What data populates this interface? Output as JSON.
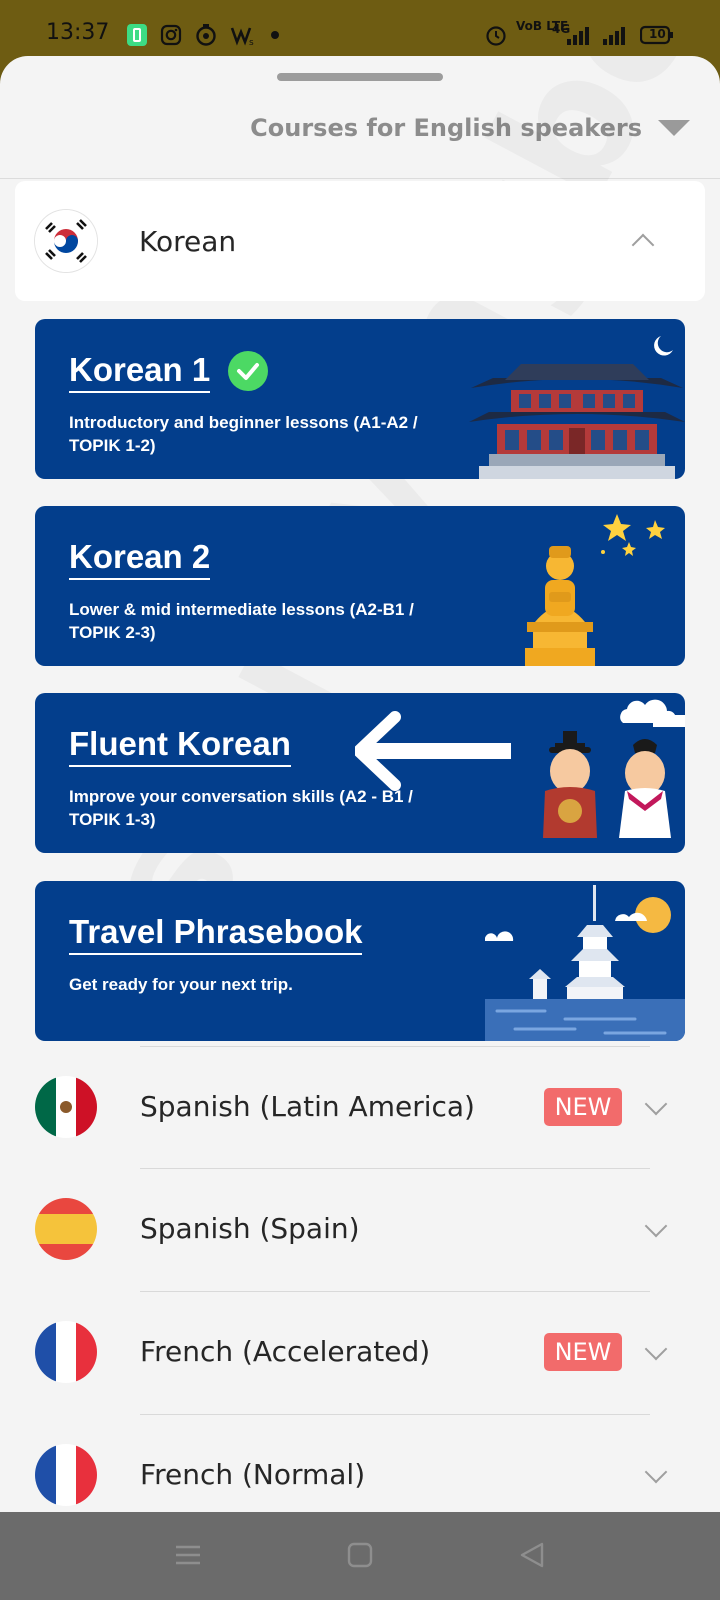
{
  "status_bar": {
    "time": "13:37",
    "network_label": "VoB LTE",
    "lte_label": "4G",
    "battery": "10",
    "icons": [
      "battery-saver-icon",
      "instagram-icon",
      "app-icon",
      "wattpad-icon",
      "alarm-icon",
      "signal-icon"
    ]
  },
  "header": {
    "course_selector": "Courses for English speakers"
  },
  "korean": {
    "label": "Korean",
    "courses": [
      {
        "title": "Korean 1",
        "desc": "Introductory and beginner lessons (A1-A2 / TOPIK 1-2)",
        "completed": true
      },
      {
        "title": "Korean 2",
        "desc": "Lower & mid intermediate lessons (A2-B1 / TOPIK 2-3)"
      },
      {
        "title": "Fluent Korean",
        "desc": "Improve your conversation skills (A2 - B1 / TOPIK 1-3)"
      },
      {
        "title": "Travel Phrasebook",
        "desc": "Get ready for your next trip."
      }
    ]
  },
  "languages": [
    {
      "label": "Spanish (Latin America)",
      "badge": "NEW"
    },
    {
      "label": "Spanish (Spain)",
      "badge": ""
    },
    {
      "label": "French (Accelerated)",
      "badge": "NEW"
    },
    {
      "label": "French (Normal)",
      "badge": ""
    }
  ],
  "watermark": "studyingbook.com",
  "colors": {
    "card_blue": "#033e8c",
    "badge_red": "#f26b6b",
    "sheet_bg": "#f4f4f4",
    "status_bg": "#6e5c12"
  }
}
